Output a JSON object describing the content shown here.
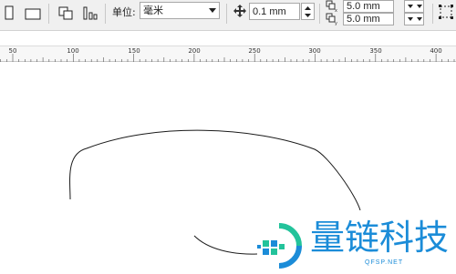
{
  "property_bar": {
    "unit_label": "单位:",
    "unit_value": "毫米",
    "nudge_value": "0.1 mm",
    "duplicate_x_value": "5.0 mm",
    "duplicate_y_value": "5.0 mm",
    "icons": {
      "portrait": "portrait-page-icon",
      "landscape": "landscape-page-icon",
      "all_pages": "all-pages-icon",
      "current_page": "current-page-icon",
      "nudge": "nudge-icon",
      "dup_x": "duplicate-x-icon",
      "dup_y": "duplicate-y-icon",
      "treat_as_filled": "frame-icon"
    }
  },
  "ruler": {
    "labels": [
      "50",
      "100",
      "150",
      "200",
      "250",
      "300",
      "350",
      "400"
    ]
  },
  "watermark": {
    "title": "量链科技",
    "subtitle": "QFSP.NET",
    "color": "#1b8cd8"
  }
}
